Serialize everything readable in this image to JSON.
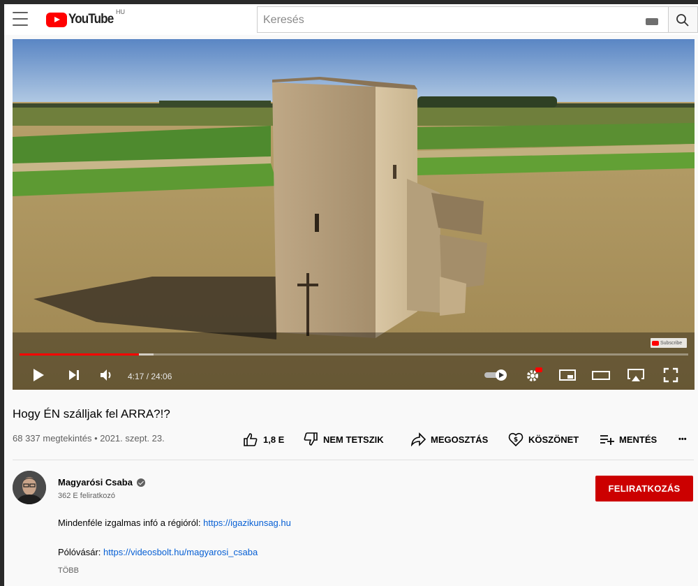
{
  "header": {
    "logo_text": "YouTube",
    "region": "HU",
    "search_placeholder": "Keresés"
  },
  "player": {
    "time": "4:17 / 24:06",
    "progress": 0.178,
    "buffered": 0.2,
    "watermark": "Subscribe",
    "quality_badge": "HD"
  },
  "video": {
    "title": "Hogy ÉN szálljak fel ARRA?!?",
    "meta": "68 337 megtekintés • 2021. szept. 23.",
    "actions": {
      "like_count": "1,8 E",
      "dislike": "NEM TETSZIK",
      "share": "MEGOSZTÁS",
      "thanks": "KÖSZÖNET",
      "save": "MENTÉS",
      "more": "•••"
    }
  },
  "channel": {
    "name": "Magyarósi Csaba",
    "subscribers": "362 E feliratkozó",
    "subscribe_label": "FELIRATKOZÁS"
  },
  "description": {
    "line1_text": "Mindenféle izgalmas infó a régióról: ",
    "line1_link": "https://igazikunsag.hu",
    "line2_text": "Pólóvásár: ",
    "line2_link": "https://videosbolt.hu/magyarosi_csaba",
    "more_label": "TÖBB"
  },
  "colors": {
    "accent": "#cc0000",
    "link": "#065fd4",
    "progress": "#ff0000"
  }
}
